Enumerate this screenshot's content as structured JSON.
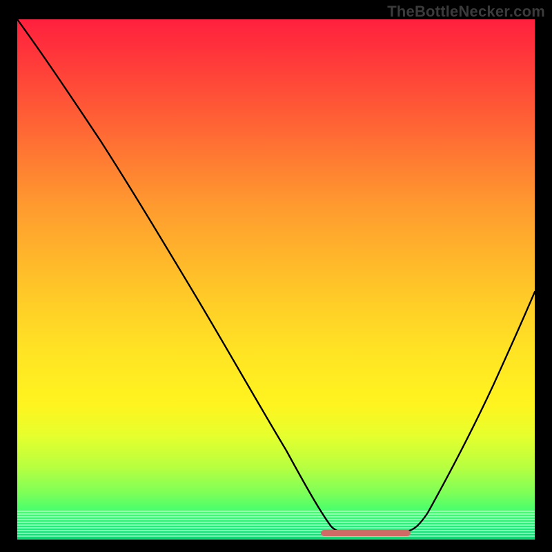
{
  "attribution": "TheBottleNecker.com",
  "chart_data": {
    "type": "line",
    "title": "",
    "xlabel": "",
    "ylabel": "",
    "xlim": [
      0,
      100
    ],
    "ylim": [
      0,
      100
    ],
    "x": [
      0,
      5,
      10,
      15,
      20,
      25,
      30,
      35,
      40,
      45,
      50,
      55,
      58,
      60,
      63,
      67,
      72,
      76,
      80,
      85,
      90,
      95,
      100
    ],
    "values": [
      100,
      94,
      86,
      79,
      71,
      63,
      55,
      47,
      38,
      29,
      20,
      11,
      5,
      2,
      1,
      1,
      1,
      2,
      6,
      15,
      26,
      39,
      53
    ],
    "highlight_region": {
      "x_from": 59,
      "x_to": 76,
      "value": 1
    },
    "annotations": []
  },
  "colors": {
    "frame": "#000000",
    "curve": "#000000",
    "highlight": "#cf6a66",
    "gradient_top": "#ff203e",
    "gradient_bottom": "#0fd474"
  }
}
